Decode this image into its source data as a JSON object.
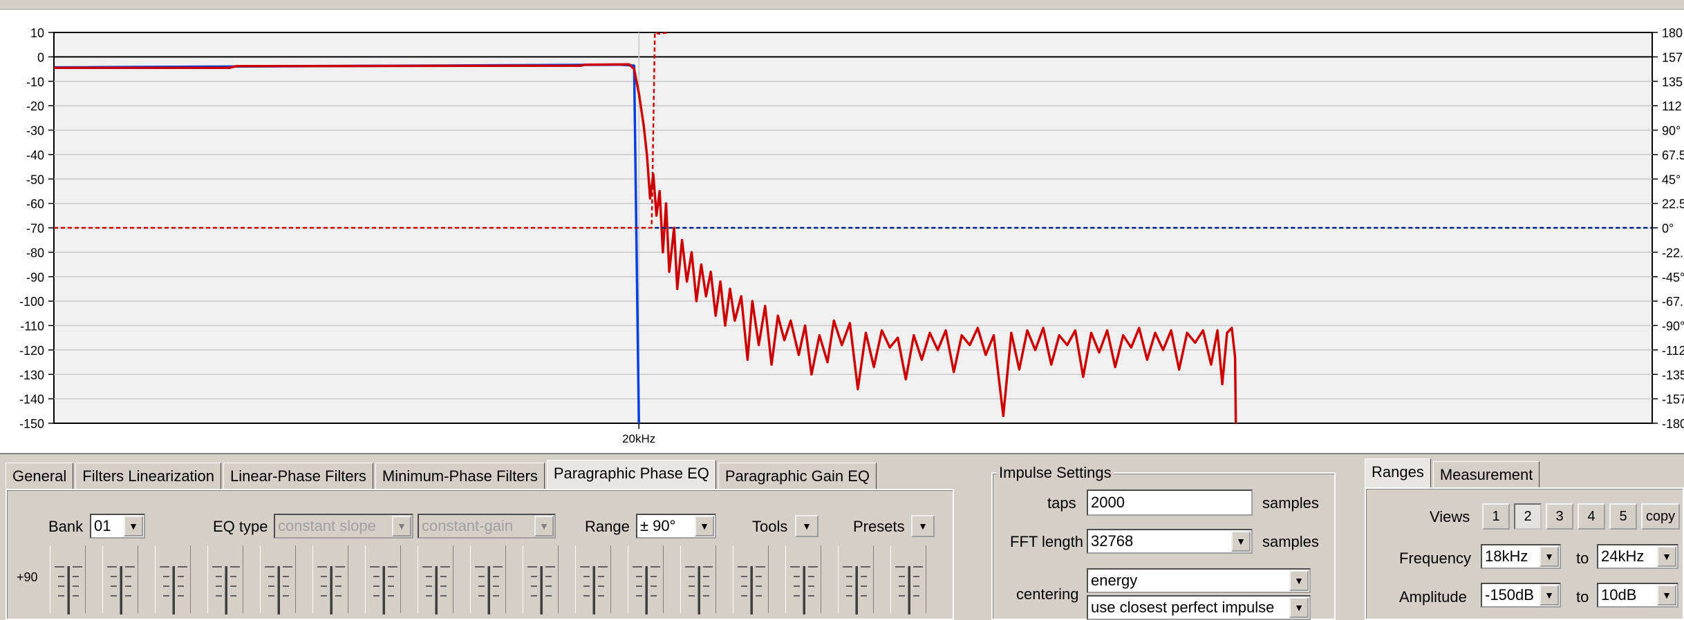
{
  "chart_data": {
    "type": "line",
    "xlabel": "",
    "ylabel": "",
    "x_tick_labels": [
      "20kHz"
    ],
    "y_left_ticks": [
      "10",
      "0",
      "-10",
      "-20",
      "-30",
      "-40",
      "-50",
      "-60",
      "-70",
      "-80",
      "-90",
      "-100",
      "-110",
      "-120",
      "-130",
      "-140",
      "-150"
    ],
    "y_right_ticks": [
      "180",
      "157",
      "135",
      "112",
      "90°",
      "67.5",
      "45°",
      "22.5",
      "0°",
      "-22.",
      "-45°",
      "-67.",
      "-90°",
      "-112",
      "-135",
      "-157",
      "-180"
    ],
    "ylim": [
      -150,
      10
    ],
    "grid": true,
    "series": [
      {
        "color": "#0040e0",
        "points": [
          [
            0,
            -4.3
          ],
          [
            0.355,
            -3.2
          ],
          [
            0.363,
            -3.6
          ],
          [
            0.366,
            -150
          ]
        ]
      },
      {
        "color": "#cc0000",
        "points": [
          [
            0,
            -4.5
          ],
          [
            0.11,
            -4.5
          ],
          [
            0.114,
            -3.8
          ],
          [
            0.33,
            -3.6
          ],
          [
            0.332,
            -3.2
          ],
          [
            0.36,
            -3.1
          ],
          [
            0.363,
            -5
          ],
          [
            0.366,
            -15
          ],
          [
            0.369,
            -28
          ],
          [
            0.371,
            -40
          ],
          [
            0.373,
            -58
          ],
          [
            0.375,
            -48
          ],
          [
            0.377,
            -65
          ],
          [
            0.379,
            -55
          ],
          [
            0.381,
            -80
          ],
          [
            0.383,
            -60
          ],
          [
            0.385,
            -88
          ],
          [
            0.388,
            -70
          ],
          [
            0.39,
            -95
          ],
          [
            0.393,
            -75
          ],
          [
            0.396,
            -92
          ],
          [
            0.399,
            -80
          ],
          [
            0.402,
            -100
          ],
          [
            0.405,
            -85
          ],
          [
            0.408,
            -98
          ],
          [
            0.411,
            -88
          ],
          [
            0.414,
            -106
          ],
          [
            0.417,
            -92
          ],
          [
            0.42,
            -110
          ],
          [
            0.423,
            -95
          ],
          [
            0.426,
            -108
          ],
          [
            0.43,
            -98
          ],
          [
            0.434,
            -124
          ],
          [
            0.437,
            -100
          ],
          [
            0.441,
            -118
          ],
          [
            0.445,
            -102
          ],
          [
            0.449,
            -126
          ],
          [
            0.453,
            -106
          ],
          [
            0.457,
            -116
          ],
          [
            0.461,
            -108
          ],
          [
            0.466,
            -122
          ],
          [
            0.47,
            -110
          ],
          [
            0.474,
            -130
          ],
          [
            0.479,
            -114
          ],
          [
            0.484,
            -125
          ],
          [
            0.488,
            -108
          ],
          [
            0.493,
            -118
          ],
          [
            0.498,
            -109
          ],
          [
            0.503,
            -136
          ],
          [
            0.508,
            -113
          ],
          [
            0.513,
            -127
          ],
          [
            0.518,
            -112
          ],
          [
            0.523,
            -119
          ],
          [
            0.528,
            -115
          ],
          [
            0.533,
            -132
          ],
          [
            0.538,
            -114
          ],
          [
            0.543,
            -124
          ],
          [
            0.548,
            -113
          ],
          [
            0.553,
            -120
          ],
          [
            0.558,
            -112
          ],
          [
            0.563,
            -129
          ],
          [
            0.568,
            -114
          ],
          [
            0.573,
            -118
          ],
          [
            0.578,
            -111
          ],
          [
            0.583,
            -122
          ],
          [
            0.588,
            -114
          ],
          [
            0.594,
            -147
          ],
          [
            0.599,
            -113
          ],
          [
            0.604,
            -128
          ],
          [
            0.609,
            -112
          ],
          [
            0.614,
            -120
          ],
          [
            0.619,
            -111
          ],
          [
            0.624,
            -126
          ],
          [
            0.629,
            -114
          ],
          [
            0.634,
            -118
          ],
          [
            0.639,
            -112
          ],
          [
            0.644,
            -131
          ],
          [
            0.649,
            -113
          ],
          [
            0.654,
            -121
          ],
          [
            0.659,
            -112
          ],
          [
            0.664,
            -127
          ],
          [
            0.669,
            -114
          ],
          [
            0.674,
            -119
          ],
          [
            0.679,
            -111
          ],
          [
            0.684,
            -124
          ],
          [
            0.689,
            -113
          ],
          [
            0.694,
            -120
          ],
          [
            0.699,
            -112
          ],
          [
            0.704,
            -128
          ],
          [
            0.709,
            -113
          ],
          [
            0.714,
            -117
          ],
          [
            0.719,
            -112
          ],
          [
            0.724,
            -126
          ],
          [
            0.728,
            -112
          ],
          [
            0.731,
            -134
          ],
          [
            0.734,
            -113
          ],
          [
            0.737,
            -111
          ],
          [
            0.739,
            -123
          ],
          [
            0.7395,
            -150
          ]
        ]
      },
      {
        "color": "#cc0000",
        "dashed": true,
        "points": [
          [
            0,
            -70
          ],
          [
            0.374,
            -70
          ],
          [
            0.376,
            10
          ],
          [
            0.377,
            10
          ],
          [
            0.378,
            9.5
          ],
          [
            0.379,
            9.5
          ],
          [
            0.385,
            10
          ]
        ]
      },
      {
        "color": "#002080",
        "dashed": true,
        "points": [
          [
            0.376,
            -70
          ],
          [
            1,
            -70
          ]
        ]
      }
    ]
  },
  "tabs": {
    "main": [
      "General",
      "Filters Linearization",
      "Linear-Phase Filters",
      "Minimum-Phase Filters",
      "Paragraphic Phase EQ",
      "Paragraphic Gain EQ"
    ],
    "main_active_index": 4,
    "right": [
      "Ranges",
      "Measurement"
    ],
    "right_active_index": 0
  },
  "eq_panel": {
    "bank_label": "Bank",
    "bank_value": "01",
    "eq_type_label": "EQ type",
    "eq_type_value": "constant slope",
    "eq_mode_value": "constant-gain",
    "range_label": "Range",
    "range_value": "± 90°",
    "tools_label": "Tools",
    "presets_label": "Presets",
    "scale_top": "+90"
  },
  "impulse": {
    "group_label": "Impulse Settings",
    "taps_label": "taps",
    "taps_value": "2000",
    "taps_unit": "samples",
    "fft_label": "FFT length",
    "fft_value": "32768",
    "fft_unit": "samples",
    "centering_label": "centering",
    "centering_value": "energy",
    "centering_option2": "use closest perfect impulse"
  },
  "ranges": {
    "views_label": "Views",
    "views": [
      "1",
      "2",
      "3",
      "4",
      "5"
    ],
    "views_active": "2",
    "copy_label": "copy",
    "frequency_label": "Frequency",
    "frequency_from": "18kHz",
    "frequency_to": "24kHz",
    "amplitude_label": "Amplitude",
    "amplitude_from": "-150dB",
    "amplitude_to": "10dB",
    "to_label": "to"
  }
}
